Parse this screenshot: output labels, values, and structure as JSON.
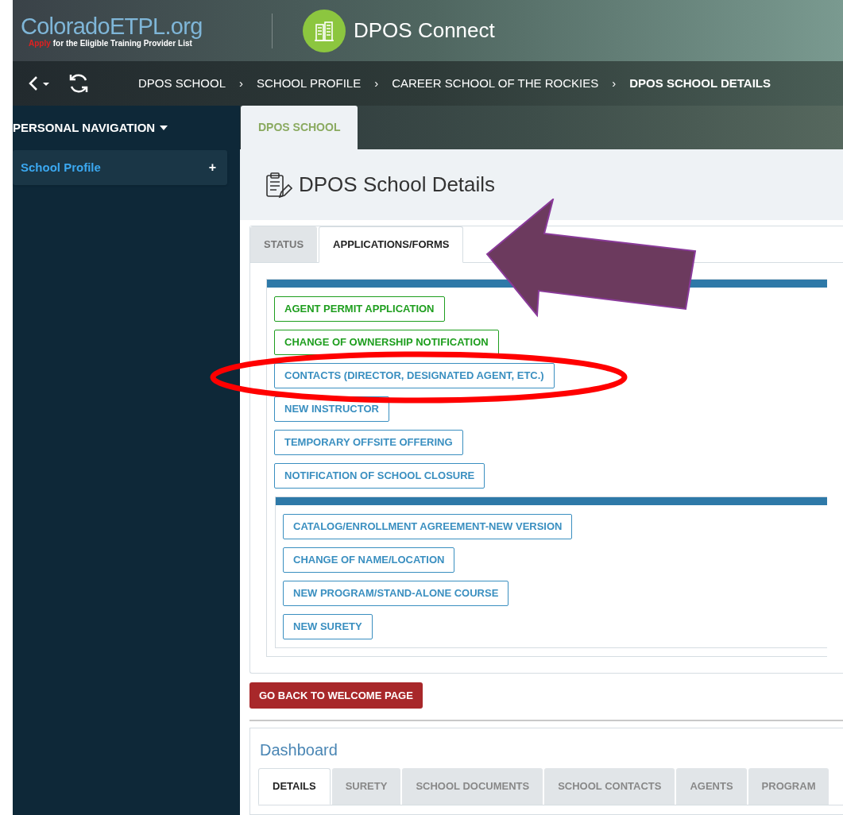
{
  "header": {
    "logo_title": "ColoradoETPL.org",
    "logo_highlight": "Apply",
    "logo_tagline": "for the Eligible Training Provider List",
    "app_name": "DPOS Connect"
  },
  "toolbar": {
    "breadcrumbs": [
      {
        "label": "DPOS SCHOOL",
        "current": false
      },
      {
        "label": "SCHOOL PROFILE",
        "current": false
      },
      {
        "label": "CAREER SCHOOL OF THE ROCKIES",
        "current": false
      },
      {
        "label": "DPOS SCHOOL DETAILS",
        "current": true
      }
    ],
    "separator": "›"
  },
  "sidebar": {
    "heading": "PERSONAL NAVIGATION",
    "items": [
      {
        "label": "School Profile",
        "expander": "+"
      }
    ]
  },
  "page_tabs": [
    {
      "label": "DPOS SCHOOL",
      "selected": true
    }
  ],
  "page_title": "DPOS School Details",
  "form_tabs": [
    {
      "label": "STATUS",
      "selected": false
    },
    {
      "label": "APPLICATIONS/FORMS",
      "selected": true
    }
  ],
  "form_groups": [
    {
      "buttons": [
        {
          "label": "AGENT PERMIT APPLICATION",
          "color": "#1e9e1e"
        },
        {
          "label": "CHANGE OF OWNERSHIP NOTIFICATION",
          "color": "#1e9e1e"
        },
        {
          "label": "CONTACTS (DIRECTOR, DESIGNATED AGENT, ETC.)",
          "color": "#3a8fc0"
        },
        {
          "label": "NEW INSTRUCTOR",
          "color": "#3a8fc0"
        },
        {
          "label": "TEMPORARY OFFSITE OFFERING",
          "color": "#3a8fc0"
        },
        {
          "label": "NOTIFICATION OF SCHOOL CLOSURE",
          "color": "#3a8fc0"
        }
      ]
    },
    {
      "buttons": [
        {
          "label": "CATALOG/ENROLLMENT AGREEMENT-NEW VERSION",
          "color": "#3a8fc0"
        },
        {
          "label": "CHANGE OF NAME/LOCATION",
          "color": "#3a8fc0"
        },
        {
          "label": "NEW PROGRAM/STAND-ALONE COURSE",
          "color": "#3a8fc0"
        },
        {
          "label": "NEW SURETY",
          "color": "#3a8fc0"
        }
      ]
    }
  ],
  "back_button": "GO BACK TO WELCOME PAGE",
  "dashboard": {
    "title": "Dashboard",
    "tabs": [
      {
        "label": "DETAILS",
        "selected": true
      },
      {
        "label": "SURETY",
        "selected": false
      },
      {
        "label": "SCHOOL DOCUMENTS",
        "selected": false
      },
      {
        "label": "SCHOOL CONTACTS",
        "selected": false
      },
      {
        "label": "AGENTS",
        "selected": false
      },
      {
        "label": "PROGRAM",
        "selected": false
      }
    ]
  },
  "annotations": {
    "arrow": {
      "color": "#6c3a5e"
    },
    "ellipse": {
      "color": "#ff0000"
    }
  }
}
